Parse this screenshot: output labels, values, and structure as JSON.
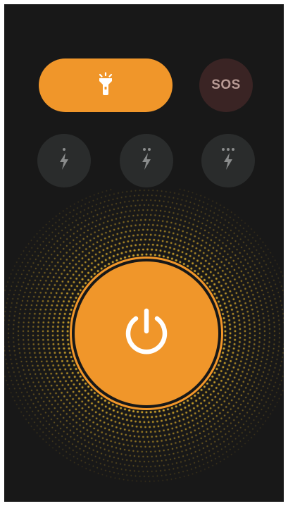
{
  "modes": {
    "torch": {
      "icon": "flashlight-icon",
      "state": "active"
    },
    "sos": {
      "label": "SOS"
    },
    "strobe": [
      {
        "icon": "lightning-bolt-icon",
        "level": 1
      },
      {
        "icon": "lightning-bolt-icon",
        "level": 2
      },
      {
        "icon": "lightning-bolt-icon",
        "level": 3
      }
    ]
  },
  "power": {
    "icon": "power-icon",
    "state": "on"
  },
  "colors": {
    "background": "#181818",
    "accent": "#f0962a",
    "sos_background": "#3a2424",
    "sos_text": "#b89a94",
    "strobe_background": "#2a2c2c",
    "strobe_icon": "#8a8c8c",
    "halo_dots": "#e8b830",
    "icon_on_accent": "#ffffff"
  }
}
